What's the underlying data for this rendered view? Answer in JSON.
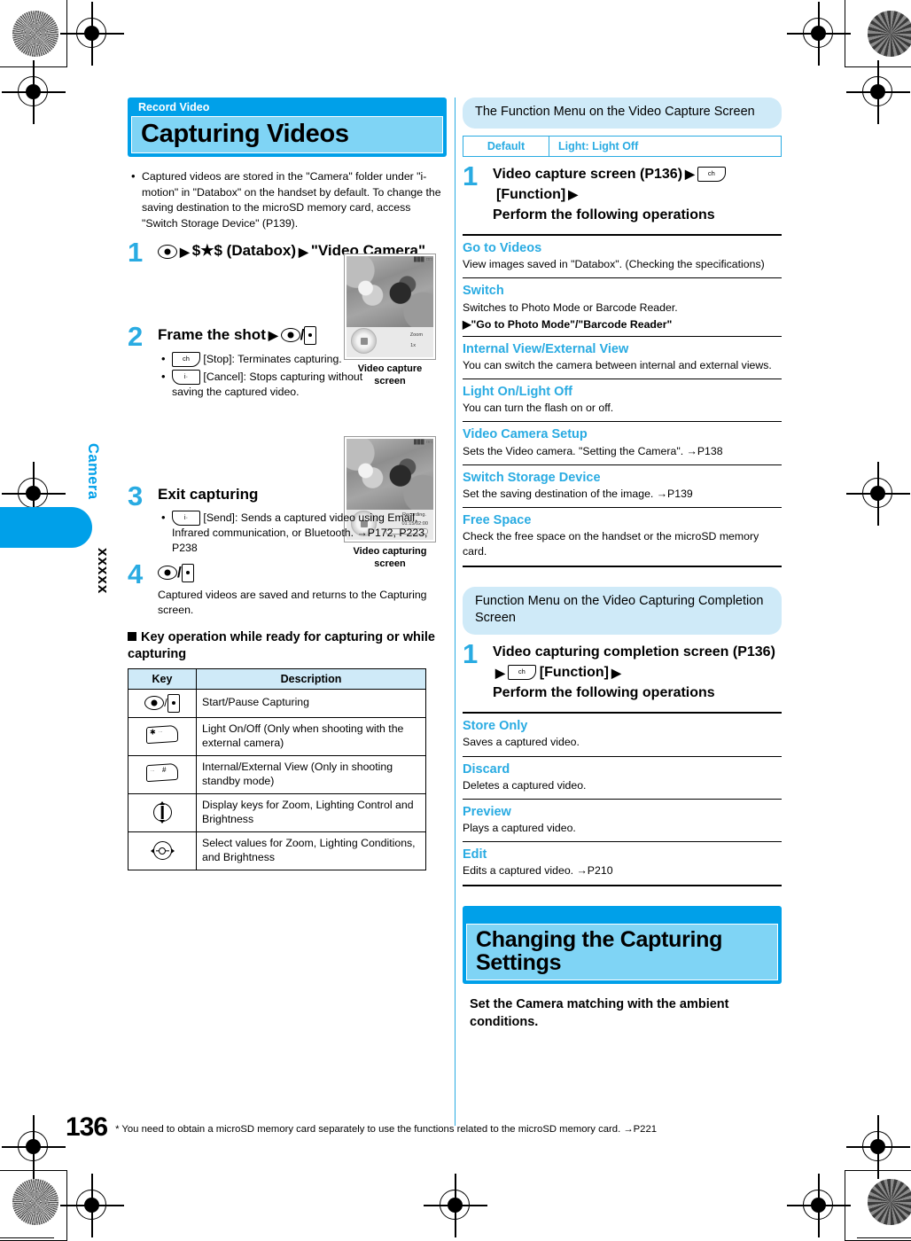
{
  "sidebar": {
    "chapter_label": "Camera",
    "chapter_code": "xxxxx"
  },
  "left_column": {
    "chapter_band": "Record Video",
    "chapter_title": "Capturing Videos",
    "intro_bullets": [
      "Captured videos are stored in the \"Camera\" folder under \"i-motion\" in \"Databox\" on the handset by default. To change the saving destination to the microSD memory card, access \"Switch Storage Device\" (P139)."
    ],
    "steps": [
      {
        "num": "1",
        "head_parts": [
          "▶",
          "$★$ (Databox)",
          "▶",
          "\"Video Camera\""
        ]
      },
      {
        "num": "2",
        "head_text": "Frame the shot",
        "bullets": [
          {
            "key_label": "ch",
            "text": "[Stop]: Terminates capturing."
          },
          {
            "key_label": "i·",
            "text": "[Cancel]: Stops capturing without saving the captured video."
          }
        ]
      },
      {
        "num": "3",
        "head_text": "Exit capturing",
        "bullets": [
          {
            "key_label": "i·",
            "text": "[Send]: Sends a captured video using Email, Infrared communication, or Bluetooth. →P172, P223, P238"
          }
        ]
      },
      {
        "num": "4",
        "body_text": "Captured videos are saved and returns to the Capturing screen."
      }
    ],
    "screenshots": [
      {
        "caption": "Video capture screen",
        "status": "███ □□",
        "label_right_1": "Zoom",
        "label_right_2": "1x"
      },
      {
        "caption": "Video capturing screen",
        "status": "███ □□",
        "label_right_1": "Recording.",
        "label_right_2": "01:15/02:00"
      }
    ],
    "key_section_title": "Key operation while ready for capturing or while capturing",
    "key_table": {
      "headers": [
        "Key",
        "Description"
      ],
      "rows": [
        {
          "key_type": "center-side",
          "key_text": "",
          "description": "Start/Pause Capturing"
        },
        {
          "key_type": "star-key",
          "key_text": "✱",
          "key_sub": "···",
          "description": "Light On/Off (Only when shooting with the external camera)"
        },
        {
          "key_type": "hash-key",
          "key_text": "#",
          "key_sub": "···",
          "description": "Internal/External View (Only in shooting standby mode)"
        },
        {
          "key_type": "ring-vert",
          "key_text": "",
          "description": "Display keys for Zoom, Lighting Control and Brightness"
        },
        {
          "key_type": "ring-horz",
          "key_text": "",
          "description": "Select values for Zoom, Lighting Conditions, and Brightness"
        }
      ]
    }
  },
  "right_column": {
    "section1": {
      "title": "The Function Menu on the Video Capture Screen",
      "default_row": {
        "label": "Default",
        "value": "Light: Light Off"
      },
      "step": {
        "num": "1",
        "text_a": "Video capture screen (P136)",
        "key_label": "ch",
        "text_b": "[Function]",
        "text_c": "Perform the following operations"
      },
      "items": [
        {
          "title": "Go to Videos",
          "desc": "View images saved in \"Databox\". (Checking the specifications)"
        },
        {
          "title": "Switch",
          "desc": "Switches to Photo Mode or Barcode Reader.",
          "sub": "▶\"Go to Photo Mode\"/\"Barcode Reader\""
        },
        {
          "title": "Internal View/External View",
          "desc": "You can switch the camera between internal and external views."
        },
        {
          "title": "Light On/Light Off",
          "desc": "You can turn the flash on or off."
        },
        {
          "title": "Video Camera Setup",
          "desc": "Sets the Video camera. \"Setting the Camera\". →P138"
        },
        {
          "title": "Switch Storage Device",
          "desc": "Set the saving destination of the image. →P139"
        },
        {
          "title": "Free Space",
          "desc": "Check the free space on the handset or the microSD memory card."
        }
      ]
    },
    "section2": {
      "title": "Function Menu on the Video Capturing Completion Screen",
      "step": {
        "num": "1",
        "text_a": "Video capturing completion screen (P136)",
        "key_label": "ch",
        "text_b": "[Function]",
        "text_c": "Perform the following operations"
      },
      "items": [
        {
          "title": "Store Only",
          "desc": "Saves a captured video."
        },
        {
          "title": "Discard",
          "desc": "Deletes a captured video."
        },
        {
          "title": "Preview",
          "desc": "Plays a captured video."
        },
        {
          "title": "Edit",
          "desc": "Edits a captured video. →P210"
        }
      ]
    },
    "section3": {
      "chapter_title": "Changing the Capturing Settings",
      "lead": "Set the Camera matching with the ambient conditions."
    }
  },
  "footer": {
    "page_number": "136",
    "note": "* You need to obtain a microSD memory card separately to use the functions related to the microSD memory card. →P221"
  },
  "colors": {
    "accent_blue": "#00a0e9",
    "light_blue": "#7fd4f5",
    "pale_blue": "#cfeaf8",
    "link_blue": "#29abe2"
  }
}
